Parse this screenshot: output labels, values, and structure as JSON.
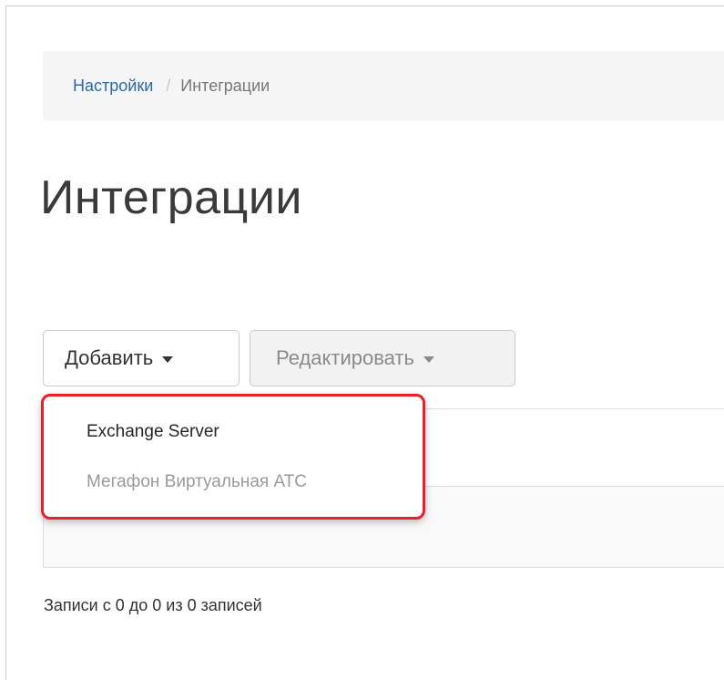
{
  "breadcrumb": {
    "parent": "Настройки",
    "separator": "/",
    "current": "Интеграции"
  },
  "page": {
    "title": "Интеграции"
  },
  "toolbar": {
    "add_label": "Добавить",
    "edit_label": "Редактировать"
  },
  "dropdown": {
    "items": [
      {
        "label": "Exchange Server"
      },
      {
        "label": "Мегафон Виртуальная АТС"
      }
    ],
    "highlight_color": "#e8202a"
  },
  "table": {
    "info": "Записи с 0 до 0 из 0 записей"
  },
  "colors": {
    "link": "#2a6aa8",
    "breadcrumb_bg": "#f5f5f5"
  }
}
